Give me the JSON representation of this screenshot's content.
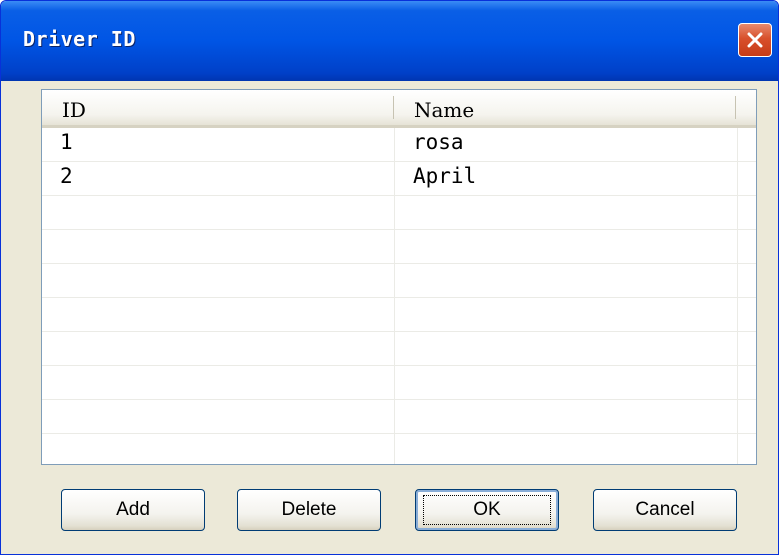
{
  "window": {
    "title": "Driver ID"
  },
  "icons": {
    "close": "close-icon"
  },
  "list": {
    "columns": [
      "ID",
      "Name"
    ],
    "rows": [
      {
        "id": "1",
        "name": "rosa"
      },
      {
        "id": "2",
        "name": "April"
      }
    ]
  },
  "buttons": {
    "add": "Add",
    "delete": "Delete",
    "ok": "OK",
    "cancel": "Cancel"
  },
  "colors": {
    "titlebar": "#0055e5",
    "close": "#d8502c",
    "face": "#ece9d8"
  }
}
